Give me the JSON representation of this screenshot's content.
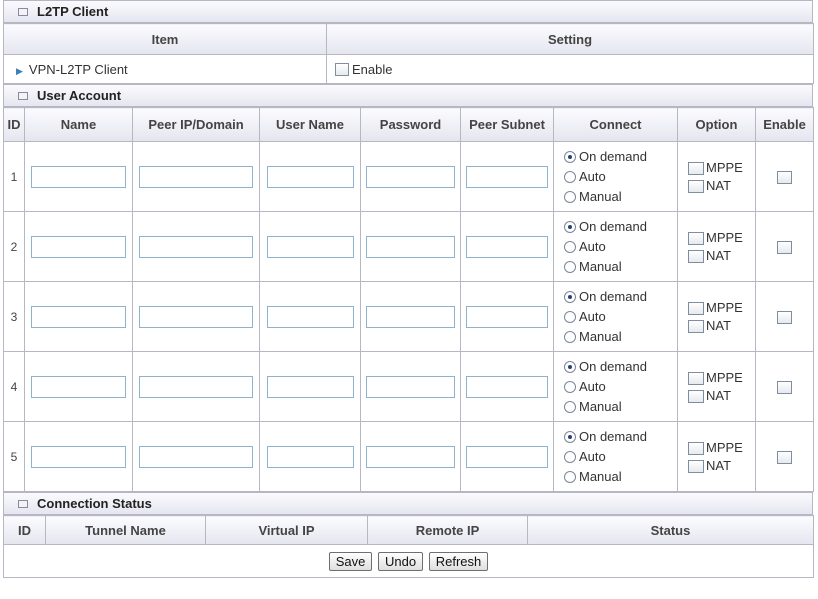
{
  "l2tp_client": {
    "title": "L2TP Client",
    "col_item": "Item",
    "col_setting": "Setting",
    "row_label": "VPN-L2TP Client",
    "enable_label": "Enable",
    "enabled": false
  },
  "user_account": {
    "title": "User Account",
    "headers": [
      "ID",
      "Name",
      "Peer IP/Domain",
      "User Name",
      "Password",
      "Peer Subnet",
      "Connect",
      "Option",
      "Enable"
    ],
    "connect_options": [
      "On demand",
      "Auto",
      "Manual"
    ],
    "option_labels": [
      "MPPE",
      "NAT"
    ],
    "rows": [
      {
        "id": "1",
        "connect_selected": "On demand"
      },
      {
        "id": "2",
        "connect_selected": "On demand"
      },
      {
        "id": "3",
        "connect_selected": "On demand"
      },
      {
        "id": "4",
        "connect_selected": "On demand"
      },
      {
        "id": "5",
        "connect_selected": "On demand"
      }
    ]
  },
  "connection_status": {
    "title": "Connection Status",
    "headers": [
      "ID",
      "Tunnel Name",
      "Virtual IP",
      "Remote IP",
      "Status"
    ]
  },
  "buttons": {
    "save": "Save",
    "undo": "Undo",
    "refresh": "Refresh"
  }
}
